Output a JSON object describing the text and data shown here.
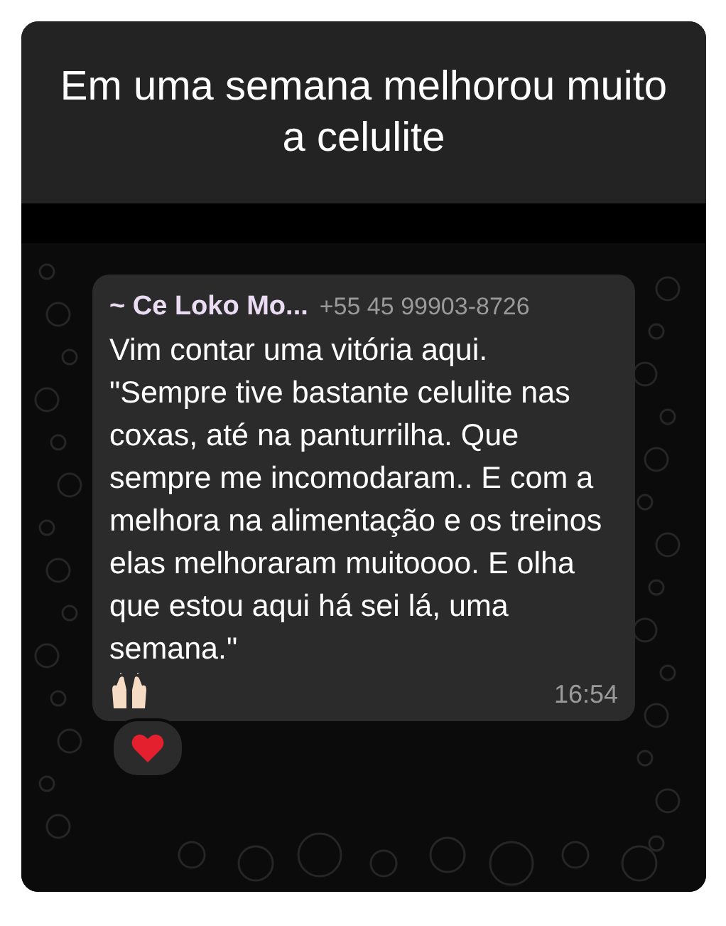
{
  "caption": "Em uma semana melhorou muito a celulite",
  "message": {
    "sender": "~ Ce Loko Mo...",
    "phone": "+55 45 99903-8726",
    "text": "Vim contar uma vitória aqui.\n\"Sempre tive bastante celulite nas coxas, até na panturrilha. Que sempre me incomodaram.. E com a melhora na alimentação e os treinos elas melhoraram muitoooo. E olha que estou aqui há sei lá, uma semana.\"",
    "time": "16:54",
    "reacted": true
  }
}
